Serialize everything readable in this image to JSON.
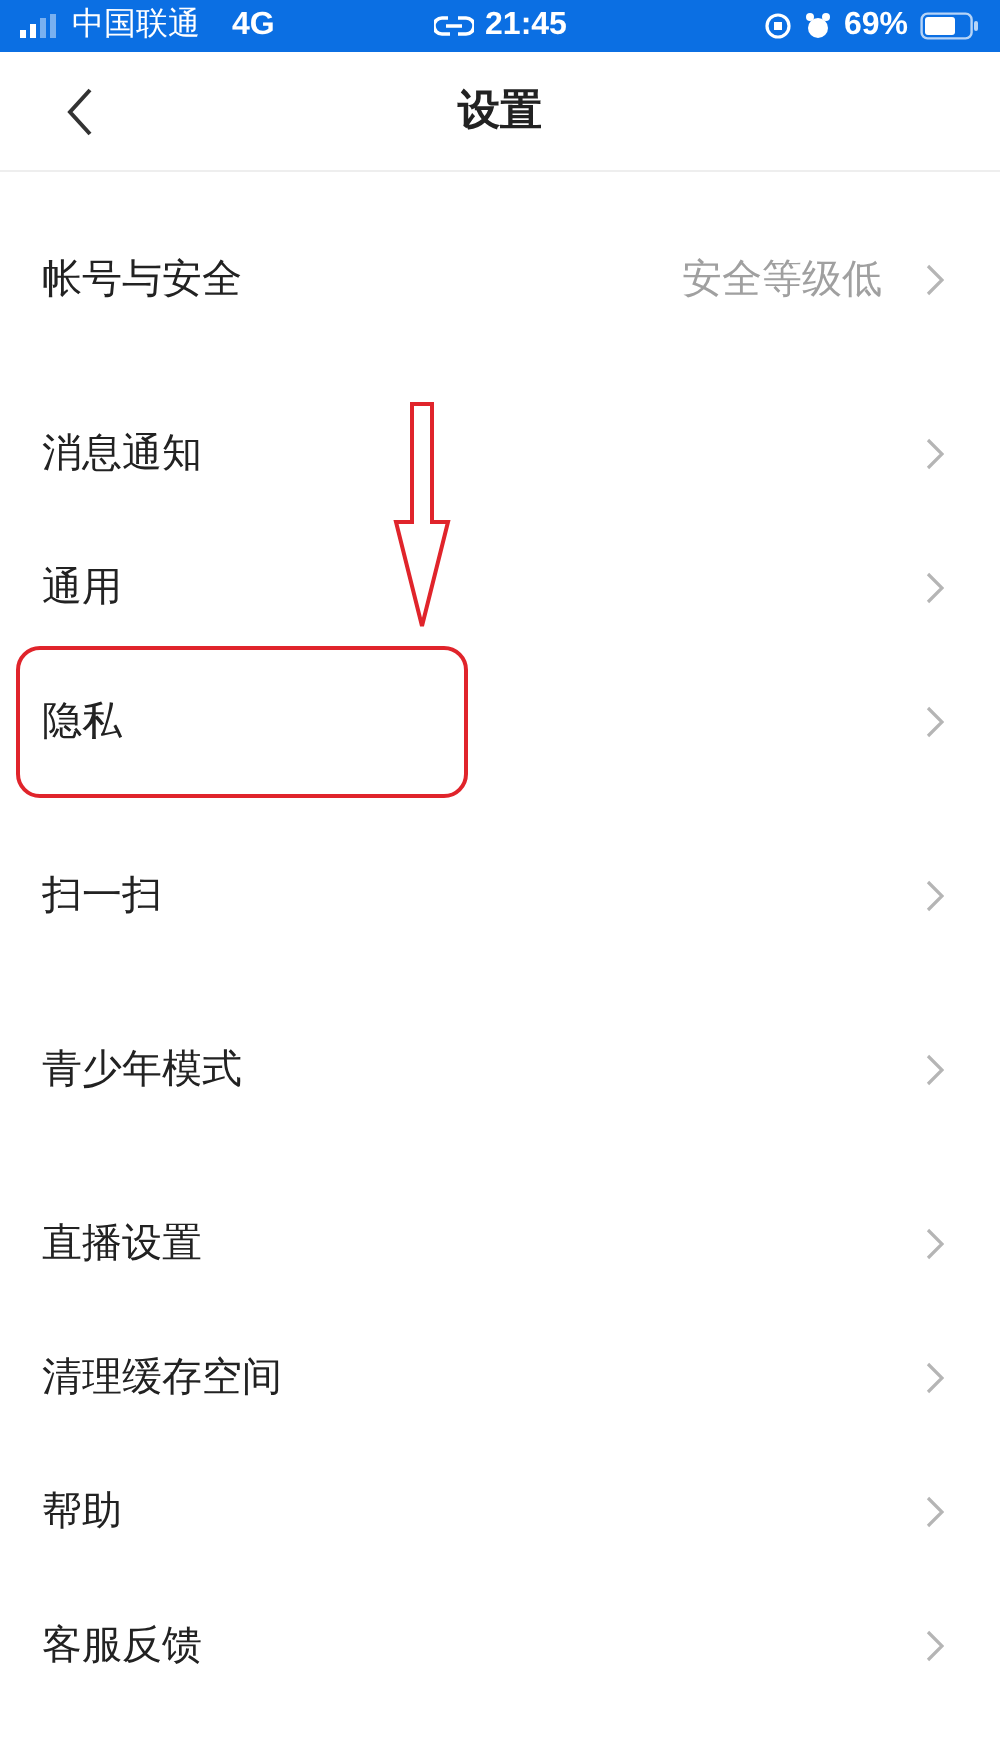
{
  "status_bar": {
    "carrier": "中国联通",
    "network": "4G",
    "time": "21:45",
    "battery": "69%"
  },
  "header": {
    "title": "设置"
  },
  "groups": [
    {
      "rows": [
        {
          "label": "帐号与安全",
          "value": "安全等级低",
          "highlighted": false
        }
      ]
    },
    {
      "rows": [
        {
          "label": "消息通知",
          "highlighted": false
        },
        {
          "label": "通用",
          "highlighted": false
        },
        {
          "label": "隐私",
          "highlighted": true
        }
      ]
    },
    {
      "rows": [
        {
          "label": "扫一扫",
          "highlighted": false
        }
      ]
    },
    {
      "rows": [
        {
          "label": "青少年模式",
          "highlighted": false
        }
      ]
    },
    {
      "rows": [
        {
          "label": "直播设置",
          "highlighted": false
        },
        {
          "label": "清理缓存空间",
          "highlighted": false
        },
        {
          "label": "帮助",
          "highlighted": false
        },
        {
          "label": "客服反馈",
          "highlighted": false
        }
      ]
    }
  ]
}
